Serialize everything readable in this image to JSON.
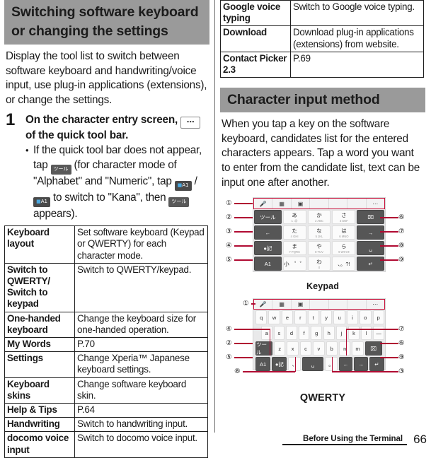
{
  "left_column": {
    "heading": "Switching software keyboard or changing the settings",
    "intro": "Display the tool list to switch between software keyboard and handwriting/voice input, use plug-in applications (extensions), or change the settings.",
    "step": {
      "number": "1",
      "title_a": "On the character entry screen,",
      "title_icon": "overflow-dots-icon",
      "title_b": "of the quick tool bar.",
      "bullet_a": "If the quick tool bar does not appear, tap",
      "chip_tool": "ツール",
      "bullet_b": "(for character mode of \"Alphabet\" and \"Numeric\", tap",
      "chip_kana1": "A1",
      "bullet_c": "/",
      "chip_kana2": "A1",
      "bullet_d": "to switch to \"Kana\", then",
      "chip_tool2": "ツール",
      "bullet_e": "appears)."
    },
    "table": [
      {
        "key": "Keyboard layout",
        "value": "Set software keyboard (Keypad or QWERTY) for each character mode."
      },
      {
        "key": "Switch to QWERTY/ Switch to keypad",
        "value": "Switch to QWERTY/keypad."
      },
      {
        "key": "One-handed keyboard",
        "value": "Change the keyboard size for one-handed operation."
      },
      {
        "key": "My Words",
        "value": "P.70"
      },
      {
        "key": "Settings",
        "value": "Change Xperia™ Japanese keyboard settings."
      },
      {
        "key": "Keyboard skins",
        "value": "Change software keyboard skin."
      },
      {
        "key": "Help & Tips",
        "value": "P.64"
      },
      {
        "key": "Handwriting",
        "value": "Switch to handwriting input."
      },
      {
        "key": "docomo voice input",
        "value": "Switch to docomo voice input."
      }
    ]
  },
  "right_column": {
    "table": [
      {
        "key": "Google voice typing",
        "value": "Switch to Google voice typing."
      },
      {
        "key": "Download",
        "value": "Download plug-in applications (extensions) from website."
      },
      {
        "key": "Contact Picker 2.3",
        "value": "P.69"
      }
    ],
    "heading": "Character input method",
    "intro": "When you tap a key on the software keyboard, candidates list for the entered characters appears. Tap a word you want to enter from the candidate list, text can be input one after another.",
    "keypad_figure": {
      "caption": "Keypad",
      "toolbar_keys": [
        "mic-icon",
        "panel-icon",
        "emoji-icon",
        "",
        "",
        "",
        "overflow-dots-icon"
      ],
      "rows": [
        [
          {
            "label": "ツール",
            "sub": "",
            "dark": true
          },
          {
            "label": "あ",
            "sub": "1    .@",
            "dark": false
          },
          {
            "label": "か",
            "sub": "2  ABC",
            "dark": false
          },
          {
            "label": "さ",
            "sub": "3  DEF",
            "dark": false
          },
          {
            "label": "⌧",
            "sub": "",
            "dark": true
          }
        ],
        [
          {
            "label": "←",
            "sub": "",
            "dark": true
          },
          {
            "label": "た",
            "sub": "4   GHI",
            "dark": false
          },
          {
            "label": "な",
            "sub": "5   JKL",
            "dark": false
          },
          {
            "label": "は",
            "sub": "6  MNO",
            "dark": false
          },
          {
            "label": "→",
            "sub": "",
            "dark": true
          }
        ],
        [
          {
            "label": "●記",
            "sub": "",
            "dark": true
          },
          {
            "label": "ま",
            "sub": "7 PQRS",
            "dark": false
          },
          {
            "label": "や",
            "sub": "8   TUV",
            "dark": false
          },
          {
            "label": "ら",
            "sub": "9 WXYZ",
            "dark": false
          },
          {
            "label": "␣",
            "sub": "",
            "dark": true
          }
        ],
        [
          {
            "label": "A1",
            "sub": "",
            "dark": true
          },
          {
            "label": "小　゜゜",
            "sub": "",
            "dark": false
          },
          {
            "label": "わ",
            "sub": "0",
            "dark": false
          },
          {
            "label": "、。?!",
            "sub": "",
            "dark": false
          },
          {
            "label": "↵",
            "sub": "",
            "dark": true
          }
        ]
      ],
      "callouts_left": [
        "①",
        "②",
        "③",
        "④",
        "⑤"
      ],
      "callouts_right": [
        "⑥",
        "⑦",
        "⑧",
        "⑨"
      ]
    },
    "qwerty_figure": {
      "caption": "QWERTY",
      "toolbar_keys": [
        "mic-icon",
        "panel-icon",
        "emoji-icon",
        "",
        "",
        "",
        "overflow-dots-icon"
      ],
      "row1": [
        "q",
        "w",
        "e",
        "r",
        "t",
        "y",
        "u",
        "i",
        "o",
        "p"
      ],
      "row2": [
        "a",
        "s",
        "d",
        "f",
        "g",
        "h",
        "j",
        "k",
        "l",
        "—"
      ],
      "row3_lead": "ツール",
      "row3": [
        "z",
        "x",
        "c",
        "v",
        "b",
        "n",
        "m"
      ],
      "row3_tail": "⌧",
      "row4": [
        "A1",
        "●記",
        "、",
        "␣",
        "。",
        "←",
        "→",
        "↵"
      ],
      "callouts_left": [
        "①",
        "④",
        "②",
        "⑤",
        "⑧"
      ],
      "callouts_right": [
        "⑦",
        "⑥",
        "⑨",
        "③"
      ]
    }
  },
  "footer": {
    "label": "Before Using the Terminal",
    "page": "66"
  },
  "colors": {
    "heading_band": "#9a9a9a",
    "callout_line": "#b00a32",
    "toolbar_border": "#c8103a",
    "key_dark": "#565656",
    "text": "#1a1a1a"
  }
}
